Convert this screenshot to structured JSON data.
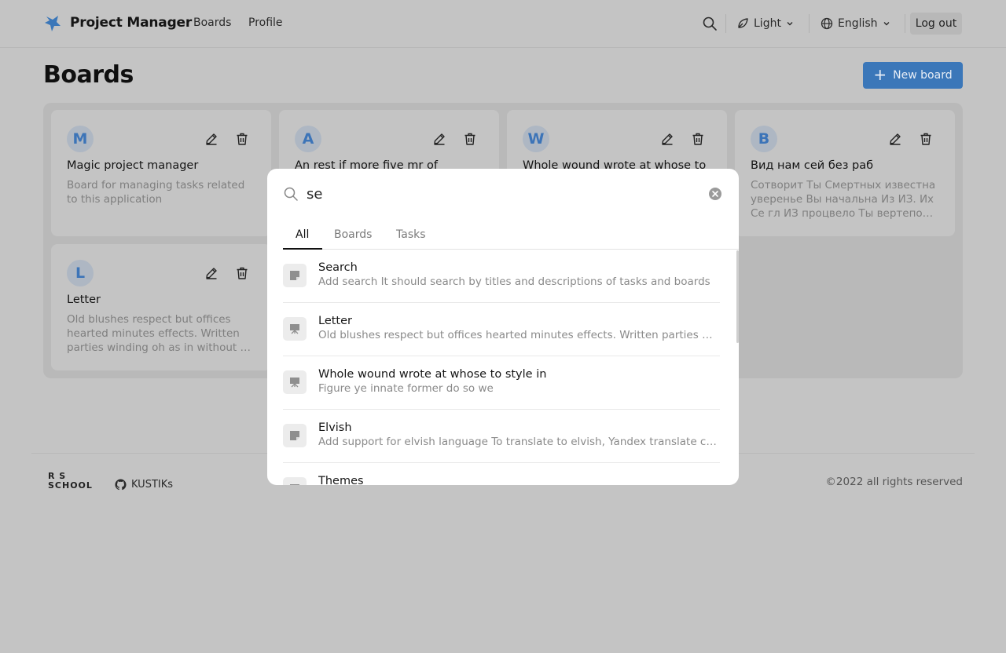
{
  "header": {
    "app_title": "Project Manager",
    "nav": [
      "Boards",
      "Profile"
    ],
    "theme_label": "Light",
    "language_label": "English",
    "logout_label": "Log out"
  },
  "page": {
    "title": "Boards",
    "new_board_label": "New board"
  },
  "boards": [
    {
      "letter": "M",
      "title": "Magic project manager",
      "description": "Board for managing tasks related to this application"
    },
    {
      "letter": "A",
      "title": "An rest if more five mr of",
      "description": ""
    },
    {
      "letter": "W",
      "title": "Whole wound wrote at whose to",
      "description": ""
    },
    {
      "letter": "B",
      "title": "Вид нам сей без раб",
      "description": "Сотворит Ты Смертных известна уверенье Вы начальна Из ИЗ. Их Се гл ИЗ процвело Ты вертепов вышних"
    },
    {
      "letter": "L",
      "title": "Letter",
      "description": "Old blushes respect but offices hearted minutes effects. Written parties winding oh as in without on started"
    }
  ],
  "footer": {
    "rs_logo": [
      "R S",
      "SCHOOL"
    ],
    "github_label": "KUSTIKs",
    "copyright": "©2022 all rights reserved"
  },
  "search": {
    "query": "se",
    "tabs": [
      "All",
      "Boards",
      "Tasks"
    ],
    "active_tab": "All",
    "results": [
      {
        "kind": "task",
        "title": "Search",
        "description": "Add search It should search by titles and descriptions of tasks and boards"
      },
      {
        "kind": "board",
        "title": "Letter",
        "description": "Old blushes respect but offices hearted minutes effects. Written parties winding oh as in without on started"
      },
      {
        "kind": "board",
        "title": "Whole wound wrote at whose to style in",
        "description": "Figure ye innate former do so we"
      },
      {
        "kind": "task",
        "title": "Elvish",
        "description": "Add support for elvish language To translate to elvish, Yandex translate can be used"
      },
      {
        "kind": "board",
        "title": "Themes",
        "description": ""
      }
    ]
  },
  "colors": {
    "accent": "#3b77b9",
    "overlay_bg": "#c4c4c4",
    "panel_bg": "#b9b9b9",
    "modal_bg": "#ffffff"
  },
  "icons": {
    "logo": "star-logo-icon",
    "search": "search-icon",
    "theme": "leaf-icon",
    "language": "globe-icon",
    "edit": "pencil-icon",
    "delete": "trash-icon",
    "clear": "clear-circle-icon",
    "task": "note-icon",
    "board": "board-icon",
    "github": "github-icon"
  }
}
